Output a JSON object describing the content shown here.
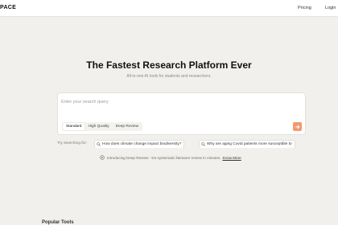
{
  "header": {
    "logo": "PACE",
    "nav": {
      "pricing": "Pricing",
      "login": "Login"
    }
  },
  "hero": {
    "title": "The Fastest Research Platform Ever",
    "subtitle": "All-in-one AI tools for students and researchers."
  },
  "search": {
    "placeholder": "Enter your search query",
    "value": "",
    "modes": [
      {
        "label": "Standard",
        "active": true
      },
      {
        "label": "High Quality",
        "active": false
      },
      {
        "label": "Deep Review",
        "active": false
      }
    ],
    "submit_icon": "arrow-right-icon",
    "accent": "#f29b6e"
  },
  "suggestions": {
    "label": "Try searching for:",
    "items": [
      "How does climate change impact biodiversity?",
      "Why are aging Covid patients more susceptible to"
    ]
  },
  "intro": {
    "text": "Introducing Deep Review - Do systematic literature review in minutes.",
    "link": "Know More"
  },
  "popular": {
    "title": "Popular Tools"
  }
}
